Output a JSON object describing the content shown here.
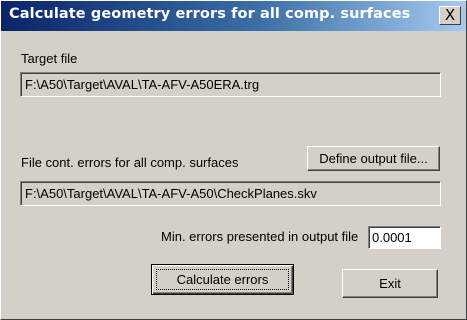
{
  "window": {
    "title": "Calculate geometry errors for all comp. surfaces",
    "close_glyph": "X"
  },
  "target": {
    "label": "Target file",
    "value": "F:\\A50\\Target\\AVAL\\TA-AFV-A50ERA.trg"
  },
  "output": {
    "label": "File cont. errors for all comp. surfaces",
    "define_button": "Define output file...",
    "value": "F:\\A50\\Target\\AVAL\\TA-AFV-A50\\CheckPlanes.skv"
  },
  "min_errors": {
    "label": "Min. errors presented in output file",
    "value": "0.0001"
  },
  "buttons": {
    "calculate": "Calculate errors",
    "exit": "Exit"
  },
  "colors": {
    "title_start": "#0a246a",
    "title_end": "#a6caf0",
    "face": "#d4d0c8"
  }
}
